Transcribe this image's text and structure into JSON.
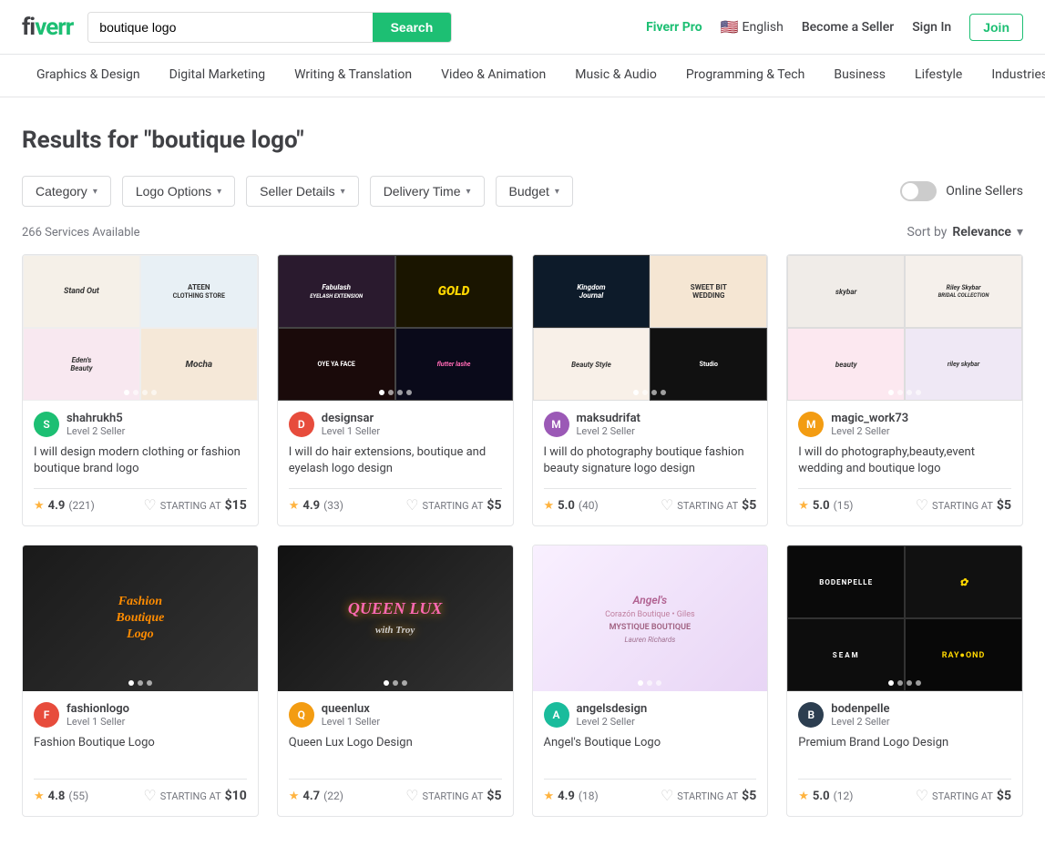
{
  "header": {
    "logo": "fiverr",
    "search_placeholder": "boutique logo",
    "search_value": "boutique logo",
    "search_button": "Search",
    "fiverr_pro": "Fiverr Pro",
    "language": "English",
    "become_seller": "Become a Seller",
    "sign_in": "Sign In",
    "join": "Join"
  },
  "nav": {
    "items": [
      "Graphics & Design",
      "Digital Marketing",
      "Writing & Translation",
      "Video & Animation",
      "Music & Audio",
      "Programming & Tech",
      "Business",
      "Lifestyle",
      "Industries"
    ]
  },
  "filters": {
    "category": "Category",
    "logo_options": "Logo Options",
    "seller_details": "Seller Details",
    "delivery_time": "Delivery Time",
    "budget": "Budget",
    "online_sellers": "Online Sellers"
  },
  "results": {
    "title": "Results for \"boutique logo\"",
    "count": "266 Services Available",
    "sort_label": "Sort by",
    "sort_value": "Relevance"
  },
  "cards": [
    {
      "id": "card1",
      "seller_name": "shahrukh5",
      "seller_level": "Level 2 Seller",
      "avatar_letter": "S",
      "avatar_bg": "#1dbf73",
      "description": "I will design modern clothing or fashion boutique brand logo",
      "rating": "4.9",
      "rating_count": "(221)",
      "starting_at": "STARTING AT",
      "price": "$15",
      "image_bg": "bg-cream",
      "image_labels": [
        "Stand Out",
        "ATEEN",
        "Eden's",
        "Mocha"
      ]
    },
    {
      "id": "card2",
      "seller_name": "designsar",
      "seller_level": "Level 1 Seller",
      "avatar_letter": "D",
      "avatar_bg": "#e74c3c",
      "description": "I will do hair extensions, boutique and eyelash logo design",
      "rating": "4.9",
      "rating_count": "(33)",
      "starting_at": "STARTING AT",
      "price": "$5",
      "image_bg": "bg-pink",
      "image_labels": [
        "Fabulash",
        "GOLD",
        "OYE YA FACE",
        "flutter lashe"
      ]
    },
    {
      "id": "card3",
      "seller_name": "maksudrifat",
      "seller_level": "Level 2 Seller",
      "avatar_letter": "M",
      "avatar_bg": "#9b59b6",
      "description": "I will do photography boutique fashion beauty signature logo design",
      "rating": "5.0",
      "rating_count": "(40)",
      "starting_at": "STARTING AT",
      "price": "$5",
      "image_bg": "bg-dark",
      "image_labels": [
        "Kingdom Journal",
        "SWEET BIT WEDDING",
        "Beauty Style",
        "Studio"
      ]
    },
    {
      "id": "card4",
      "seller_name": "magic_work73",
      "seller_level": "Level 2 Seller",
      "avatar_letter": "M",
      "avatar_bg": "#f39c12",
      "description": "I will do photography,beauty,event wedding and boutique logo",
      "rating": "5.0",
      "rating_count": "(15)",
      "starting_at": "STARTING AT",
      "price": "$5",
      "image_bg": "bg-cream",
      "image_labels": [
        "skybar",
        "Riley Skybar",
        "beauty",
        "Riley skybar"
      ]
    },
    {
      "id": "card5",
      "seller_name": "fashionlogo",
      "seller_level": "Level 1 Seller",
      "avatar_letter": "F",
      "avatar_bg": "#e74c3c",
      "description": "Fashion Boutique Logo",
      "rating": "4.8",
      "rating_count": "(55)",
      "starting_at": "STARTING AT",
      "price": "$10",
      "image_bg": "bg-fashion"
    },
    {
      "id": "card6",
      "seller_name": "queenlux",
      "seller_level": "Level 1 Seller",
      "avatar_letter": "Q",
      "avatar_bg": "#f39c12",
      "description": "Queen Lux Logo Design",
      "rating": "4.7",
      "rating_count": "(22)",
      "starting_at": "STARTING AT",
      "price": "$5",
      "image_bg": "bg-queen"
    },
    {
      "id": "card7",
      "seller_name": "angelsdesign",
      "seller_level": "Level 2 Seller",
      "avatar_letter": "A",
      "avatar_bg": "#1abc9c",
      "description": "Angel's Boutique Logo",
      "rating": "4.9",
      "rating_count": "(18)",
      "starting_at": "STARTING AT",
      "price": "$5",
      "image_bg": "bg-angel"
    },
    {
      "id": "card8",
      "seller_name": "bodenpelle",
      "seller_level": "Level 2 Seller",
      "avatar_letter": "B",
      "avatar_bg": "#2c3e50",
      "description": "Premium Brand Logo Design",
      "rating": "5.0",
      "rating_count": "(12)",
      "starting_at": "STARTING AT",
      "price": "$5",
      "image_bg": "bg-boden"
    }
  ]
}
